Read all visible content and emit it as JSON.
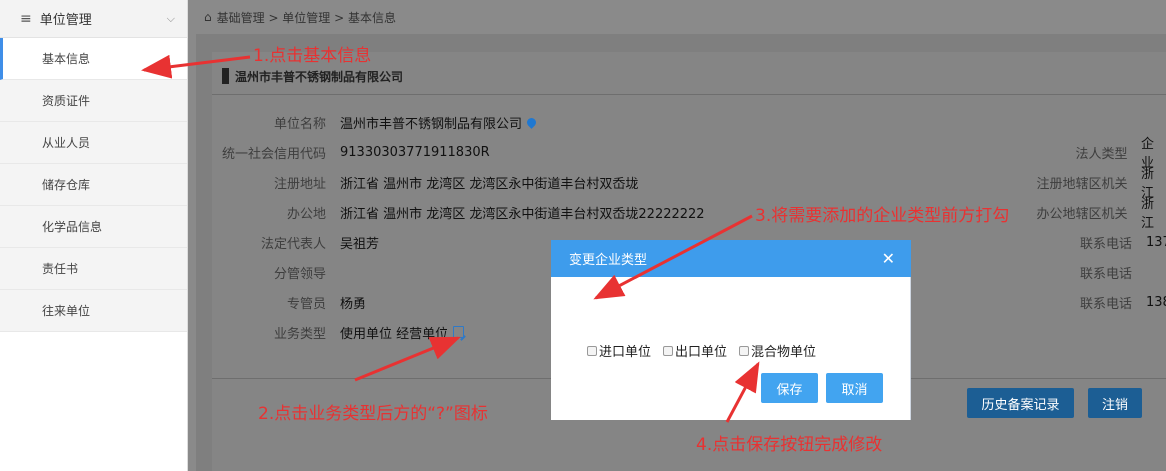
{
  "sidebar": {
    "header": "单位管理",
    "items": [
      "基本信息",
      "资质证件",
      "从业人员",
      "储存仓库",
      "化学品信息",
      "责任书",
      "往来单位"
    ]
  },
  "breadcrumb": "基础管理 > 单位管理 > 基本信息",
  "company_title": "温州市丰普不锈钢制品有限公司",
  "fields_left": [
    {
      "label": "单位名称",
      "value": "温州市丰普不锈钢制品有限公司"
    },
    {
      "label": "统一社会信用代码",
      "value": "91330303771911830R"
    },
    {
      "label": "注册地址",
      "value": "浙江省 温州市 龙湾区  龙湾区永中街道丰台村双岙垅"
    },
    {
      "label": "办公地",
      "value": "浙江省 温州市 龙湾区  龙湾区永中街道丰台村双岙垅22222222"
    },
    {
      "label": "法定代表人",
      "value": "吴祖芳"
    },
    {
      "label": "分管领导",
      "value": ""
    },
    {
      "label": "专管员",
      "value": "杨勇"
    },
    {
      "label": "业务类型",
      "value": "使用单位  经营单位"
    }
  ],
  "fields_right": [
    {
      "label": "法人类型",
      "value": "企业"
    },
    {
      "label": "注册地辖区机关",
      "value": "浙江"
    },
    {
      "label": "办公地辖区机关",
      "value": "浙江"
    },
    {
      "label": "联系电话",
      "value": "137"
    },
    {
      "label": "联系电话",
      "value": ""
    },
    {
      "label": "联系电话",
      "value": "138"
    }
  ],
  "buttons": {
    "history": "历史备案记录",
    "deregister": "注销"
  },
  "modal": {
    "title": "变更企业类型",
    "close": "✕",
    "options": [
      "进口单位",
      "出口单位",
      "混合物单位"
    ],
    "save": "保存",
    "cancel": "取消"
  },
  "annotations": {
    "a1": "1.点击基本信息",
    "a2": "2.点击业务类型后方的“?”图标",
    "a3": "3.将需要添加的企业类型前方打勾",
    "a4": "4.点击保存按钮完成修改"
  },
  "colors": {
    "accent": "#3e9cec",
    "annotation": "#e83232",
    "sidebar_active": "#3f8ee8"
  },
  "icons": {
    "home": "home-icon",
    "menu": "menu-icon",
    "pin": "location-pin-icon",
    "edit": "edit-icon",
    "close": "close-icon"
  }
}
